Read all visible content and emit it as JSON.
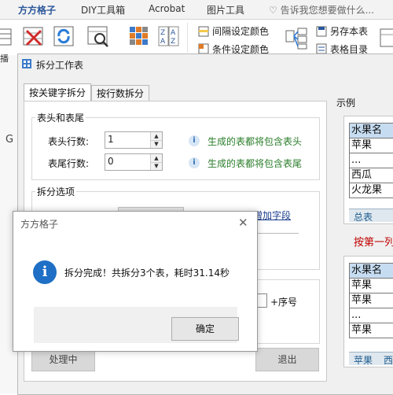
{
  "ribbon": {
    "tabs": [
      "方方格子",
      "DIY工具箱",
      "Acrobat",
      "图片工具"
    ],
    "search_hint": "告诉我您想要做什么...",
    "items": {
      "spacing_color": "间隔设定颜色",
      "condition_color": "条件设定颜色",
      "save_as": "另存本表",
      "sheet_dir": "表格目录",
      "left_partial": "播"
    }
  },
  "sheet": {
    "g_marker": "G"
  },
  "split_window": {
    "title": "拆分工作表",
    "tabs": [
      "按关键字拆分",
      "按行数拆分"
    ],
    "header_footer": {
      "group_label": "表头和表尾",
      "header_rows_label": "表头行数:",
      "header_rows_value": "1",
      "header_note": "生成的表都将包含表头",
      "footer_rows_label": "表尾行数:",
      "footer_rows_value": "0",
      "footer_note": "生成的表都将包含表尾"
    },
    "split_options": {
      "group_label": "拆分选项",
      "add_field_link": "增加字段",
      "seq_label": "+序号"
    },
    "buttons": {
      "processing": "处理中",
      "exit": "退出"
    },
    "example": {
      "label": "示例",
      "top_table": [
        "水果名",
        "苹果",
        "...",
        "西瓜",
        "火龙果"
      ],
      "top_sheet_tab": "总表",
      "note": "按第一列",
      "bottom_table": [
        "水果名",
        "苹果",
        "苹果",
        "...",
        "苹果"
      ],
      "bottom_sheet_tabs": [
        "苹果",
        "西"
      ]
    }
  },
  "dialog": {
    "title": "方方格子",
    "message": "拆分完成！共拆分3个表，耗时31.14秒",
    "ok": "确定",
    "close": "✕"
  },
  "colors": {
    "accent": "#2b579a",
    "note_green": "#2a7d2a",
    "note_red": "#c00000",
    "info_blue": "#1e6fc5",
    "table_header": "#c6dcf1"
  }
}
